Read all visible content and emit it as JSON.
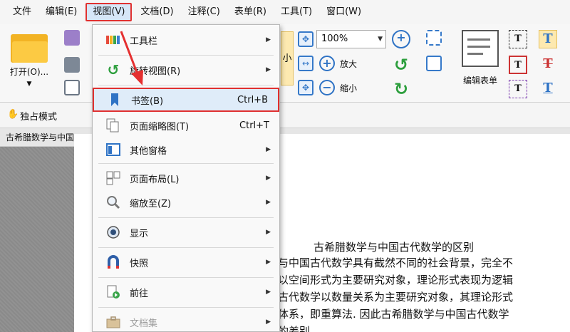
{
  "menubar": {
    "items": [
      "文件",
      "编辑(E)",
      "视图(V)",
      "文档(D)",
      "注释(C)",
      "表单(R)",
      "工具(T)",
      "窗口(W)"
    ]
  },
  "ribbon": {
    "open_label": "打开(O)...",
    "zoom_value": "100%",
    "zoom_in_label": "放大",
    "zoom_out_label": "缩小",
    "edit_form_label": "编辑表单",
    "solo_mode_label": "独占模式",
    "small_partial": "小"
  },
  "tab": {
    "title": "古希腊数学与中国"
  },
  "view_menu": {
    "items": [
      {
        "label": "工具栏",
        "shortcut": "",
        "submenu": true,
        "icon": "toolbar-icon"
      },
      {
        "label": "旋转视图(R)",
        "shortcut": "",
        "submenu": true,
        "icon": "rotate-icon"
      },
      {
        "label": "书签(B)",
        "shortcut": "Ctrl+B",
        "submenu": false,
        "icon": "bookmark-icon"
      },
      {
        "label": "页面缩略图(T)",
        "shortcut": "Ctrl+T",
        "submenu": false,
        "icon": "thumbnails-icon"
      },
      {
        "label": "其他窗格",
        "shortcut": "",
        "submenu": true,
        "icon": "panes-icon"
      },
      {
        "label": "页面布局(L)",
        "shortcut": "",
        "submenu": true,
        "icon": "page-layout-icon"
      },
      {
        "label": "缩放至(Z)",
        "shortcut": "",
        "submenu": true,
        "icon": "zoom-icon"
      },
      {
        "label": "显示",
        "shortcut": "",
        "submenu": true,
        "icon": "eye-icon"
      },
      {
        "label": "快照",
        "shortcut": "",
        "submenu": true,
        "icon": "snapshot-icon"
      },
      {
        "label": "前往",
        "shortcut": "",
        "submenu": true,
        "icon": "goto-icon"
      },
      {
        "label": "文档集",
        "shortcut": "",
        "submenu": true,
        "icon": "doc-set-icon"
      }
    ]
  },
  "document": {
    "title": "古希腊数学与中国古代数学的区别",
    "lines": [
      "与中国古代数学具有截然不同的社会背景，完全不",
      "以空间形式为主要研究对象，理论形式表现为逻辑",
      "古代数学以数量关系为主要研究对象，其理论形式",
      "体系，即重算法. 因此古希腊数学与中国古代数学",
      "的差别"
    ]
  },
  "colors": {
    "highlight_border": "#e03030",
    "highlight_bg": "#dfecf9",
    "accent_blue": "#2f73c5"
  }
}
